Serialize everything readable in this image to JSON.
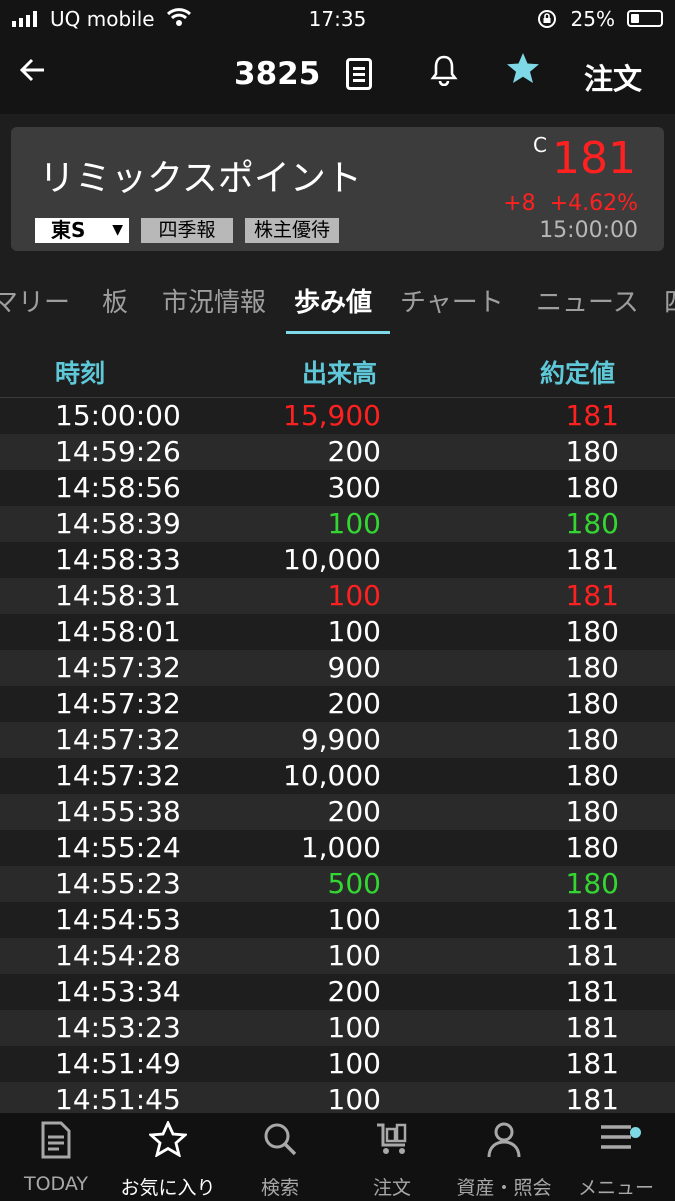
{
  "status_bar": {
    "carrier": "UQ mobile",
    "time": "17:35",
    "battery": "25%"
  },
  "nav": {
    "code": "3825",
    "order_label": "注文"
  },
  "stock": {
    "name": "リミックスポイント",
    "market": "東S",
    "tags": [
      "四季報",
      "株主優待"
    ],
    "c_label": "C",
    "price": "181",
    "change": "+8",
    "change_pct": "+4.62%",
    "time": "15:00:00",
    "price_color": "#ff2020"
  },
  "tabs": [
    "マリー",
    "板",
    "市況情報",
    "歩み値",
    "チャート",
    "ニュース",
    "四"
  ],
  "active_tab": "歩み値",
  "table": {
    "headers": [
      "時刻",
      "出来高",
      "約定値"
    ],
    "rows": [
      {
        "time": "15:00:00",
        "volume": "15,900",
        "price": "181",
        "color": "red"
      },
      {
        "time": "14:59:26",
        "volume": "200",
        "price": "180",
        "color": "white"
      },
      {
        "time": "14:58:56",
        "volume": "300",
        "price": "180",
        "color": "white"
      },
      {
        "time": "14:58:39",
        "volume": "100",
        "price": "180",
        "color": "green"
      },
      {
        "time": "14:58:33",
        "volume": "10,000",
        "price": "181",
        "color": "white"
      },
      {
        "time": "14:58:31",
        "volume": "100",
        "price": "181",
        "color": "red"
      },
      {
        "time": "14:58:01",
        "volume": "100",
        "price": "180",
        "color": "white"
      },
      {
        "time": "14:57:32",
        "volume": "900",
        "price": "180",
        "color": "white"
      },
      {
        "time": "14:57:32",
        "volume": "200",
        "price": "180",
        "color": "white"
      },
      {
        "time": "14:57:32",
        "volume": "9,900",
        "price": "180",
        "color": "white"
      },
      {
        "time": "14:57:32",
        "volume": "10,000",
        "price": "180",
        "color": "white"
      },
      {
        "time": "14:55:38",
        "volume": "200",
        "price": "180",
        "color": "white"
      },
      {
        "time": "14:55:24",
        "volume": "1,000",
        "price": "180",
        "color": "white"
      },
      {
        "time": "14:55:23",
        "volume": "500",
        "price": "180",
        "color": "green"
      },
      {
        "time": "14:54:53",
        "volume": "100",
        "price": "181",
        "color": "white"
      },
      {
        "time": "14:54:28",
        "volume": "100",
        "price": "181",
        "color": "white"
      },
      {
        "time": "14:53:34",
        "volume": "200",
        "price": "181",
        "color": "white"
      },
      {
        "time": "14:53:23",
        "volume": "100",
        "price": "181",
        "color": "white"
      },
      {
        "time": "14:51:49",
        "volume": "100",
        "price": "181",
        "color": "white"
      },
      {
        "time": "14:51:45",
        "volume": "100",
        "price": "181",
        "color": "white"
      }
    ]
  },
  "bottom_nav": [
    {
      "label": "TODAY",
      "icon": "today-icon"
    },
    {
      "label": "お気に入り",
      "icon": "star-icon"
    },
    {
      "label": "検索",
      "icon": "search-icon"
    },
    {
      "label": "注文",
      "icon": "cart-icon"
    },
    {
      "label": "資産・照会",
      "icon": "person-icon"
    },
    {
      "label": "メニュー",
      "icon": "menu-icon"
    }
  ],
  "active_bottom": "お気に入り",
  "colors": {
    "accent": "#7fd8e6",
    "up": "#ff2020",
    "down": "#33d633"
  }
}
